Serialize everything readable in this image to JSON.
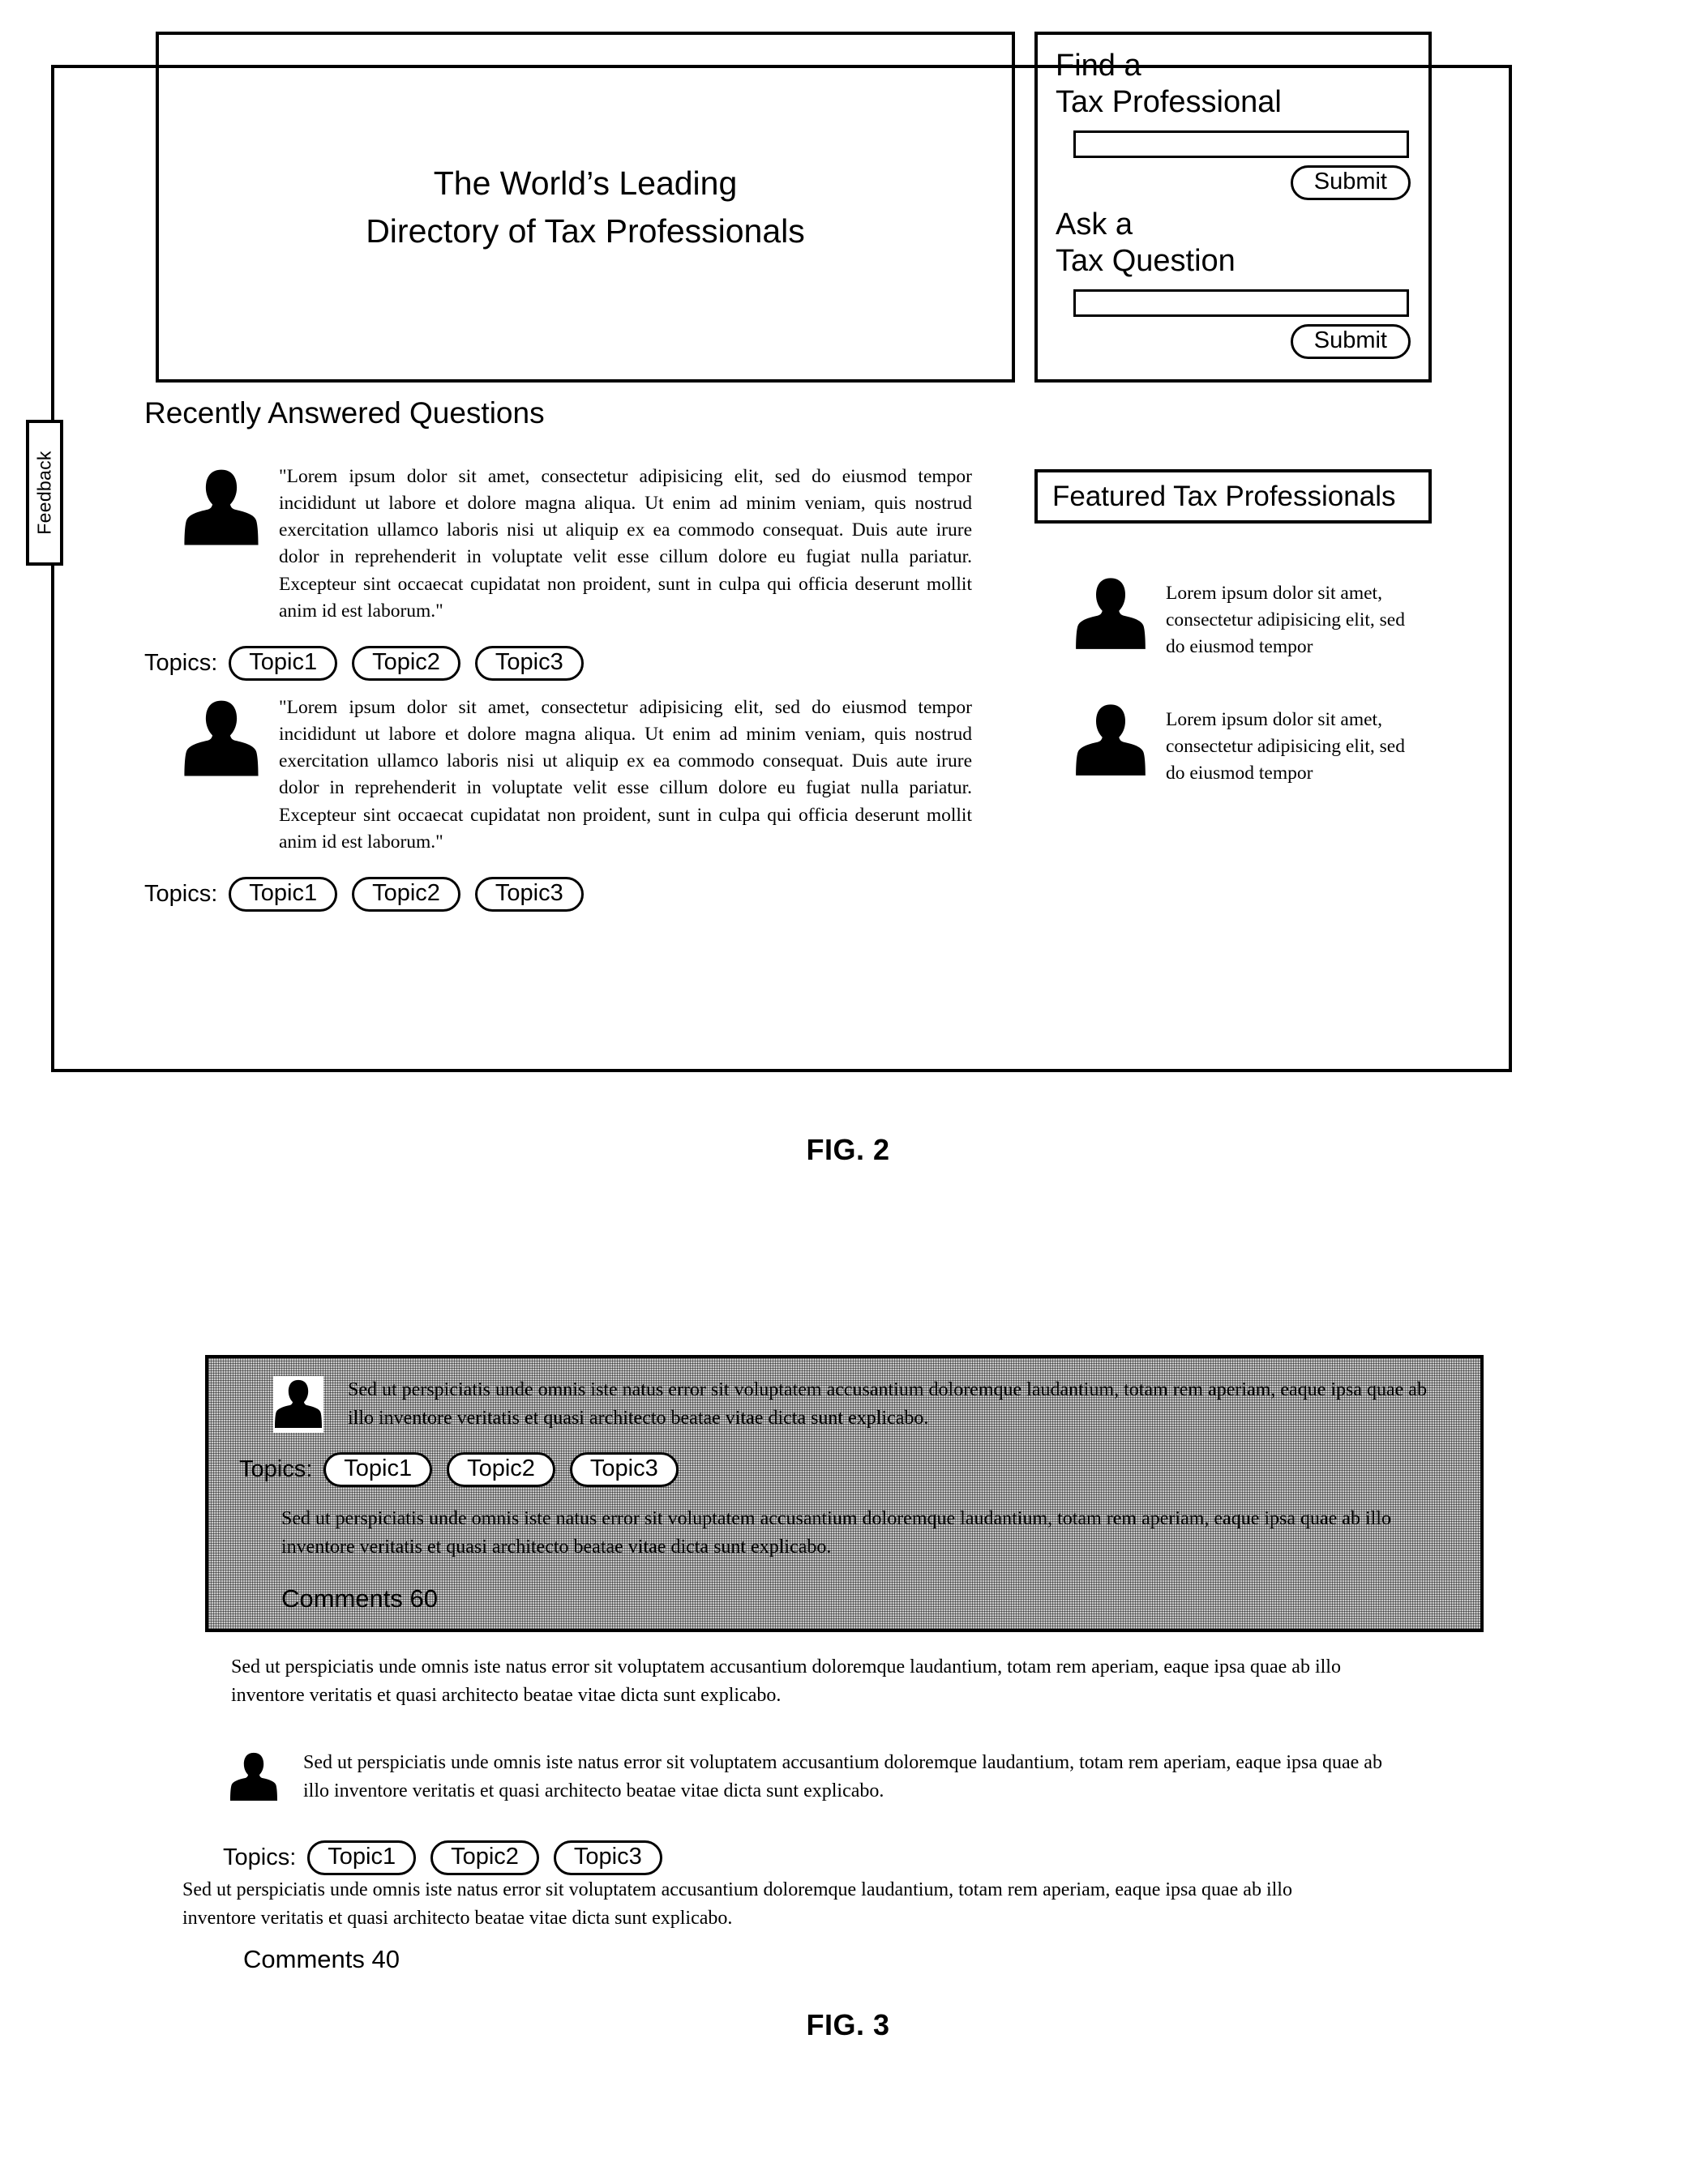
{
  "figures": {
    "fig2_caption": "FIG. 2",
    "fig3_caption": "FIG. 3"
  },
  "fig2": {
    "feedback_tab": {
      "label": "Feedback"
    },
    "hero": {
      "line1": "The World’s Leading",
      "line2": "Directory of Tax Professionals"
    },
    "search_panel": {
      "find_heading": "Find a\nTax Professional",
      "find_input_value": "",
      "find_input_placeholder": "",
      "find_submit_label": "Submit",
      "ask_heading": "Ask a\nTax Question",
      "ask_input_value": "",
      "ask_input_placeholder": "",
      "ask_submit_label": "Submit"
    },
    "recently_answered": {
      "title": "Recently Answered Questions",
      "topics_label": "Topics:",
      "items": [
        {
          "avatar": "user-silhouette-icon",
          "text": "\"Lorem ipsum dolor sit amet, consectetur adipisicing elit, sed do eiusmod tempor incididunt ut labore et dolore magna aliqua. Ut enim ad minim veniam, quis nostrud exercitation ullamco laboris nisi ut aliquip ex ea commodo consequat. Duis aute irure dolor in reprehenderit in voluptate velit esse cillum dolore eu fugiat nulla pariatur. Excepteur sint occaecat cupidatat non proident, sunt in culpa qui officia deserunt mollit anim id est laborum.\"",
          "topics": [
            "Topic1",
            "Topic2",
            "Topic3"
          ]
        },
        {
          "avatar": "user-silhouette-icon",
          "text": "\"Lorem ipsum dolor sit amet, consectetur adipisicing elit, sed do eiusmod tempor incididunt ut labore et dolore magna aliqua. Ut enim ad minim veniam, quis nostrud exercitation ullamco laboris nisi ut aliquip ex ea commodo consequat. Duis aute irure dolor in reprehenderit in voluptate velit esse cillum dolore eu fugiat nulla pariatur. Excepteur sint occaecat cupidatat non proident, sunt in culpa qui officia deserunt mollit anim id est laborum.\"",
          "topics": [
            "Topic1",
            "Topic2",
            "Topic3"
          ]
        }
      ]
    },
    "featured": {
      "title": "Featured Tax Professionals",
      "items": [
        {
          "avatar": "user-silhouette-icon",
          "text": "Lorem ipsum dolor sit amet, consectetur adipisicing elit, sed do eiusmod tempor"
        },
        {
          "avatar": "user-silhouette-icon",
          "text": "Lorem ipsum dolor sit amet, consectetur adipisicing elit, sed do eiusmod tempor"
        }
      ]
    }
  },
  "fig3": {
    "highlight_card": {
      "avatar": "user-silhouette-icon",
      "question": "Sed ut perspiciatis unde omnis iste natus error sit voluptatem accusantium doloremque laudantium, totam rem aperiam, eaque ipsa quae ab illo inventore veritatis et quasi architecto beatae vitae dicta sunt explicabo.",
      "topics_label": "Topics:",
      "topics": [
        "Topic1",
        "Topic2",
        "Topic3"
      ],
      "answer": "Sed ut perspiciatis unde omnis iste natus error sit voluptatem accusantium doloremque laudantium, totam rem aperiam, eaque ipsa quae ab illo inventore veritatis et quasi architecto beatae vitae dicta sunt explicabo.",
      "comments_label": "Comments 60"
    },
    "paragraph_after_card": "Sed ut perspiciatis unde omnis iste natus error sit voluptatem accusantium doloremque laudantium, totam rem aperiam, eaque ipsa quae ab illo inventore veritatis et quasi architecto beatae vitae dicta sunt explicabo.",
    "second_item": {
      "avatar": "user-silhouette-icon",
      "question": "Sed ut perspiciatis unde omnis iste natus error sit voluptatem accusantium doloremque laudantium, totam rem aperiam, eaque ipsa quae ab illo inventore veritatis et quasi architecto beatae vitae dicta sunt explicabo.",
      "topics_label": "Topics:",
      "topics": [
        "Topic1",
        "Topic2",
        "Topic3"
      ],
      "answer": "Sed ut perspiciatis unde omnis iste natus error sit voluptatem accusantium doloremque laudantium, totam rem aperiam, eaque ipsa quae ab illo inventore veritatis et quasi architecto beatae vitae dicta sunt explicabo.",
      "comments_label": "Comments 40"
    }
  }
}
